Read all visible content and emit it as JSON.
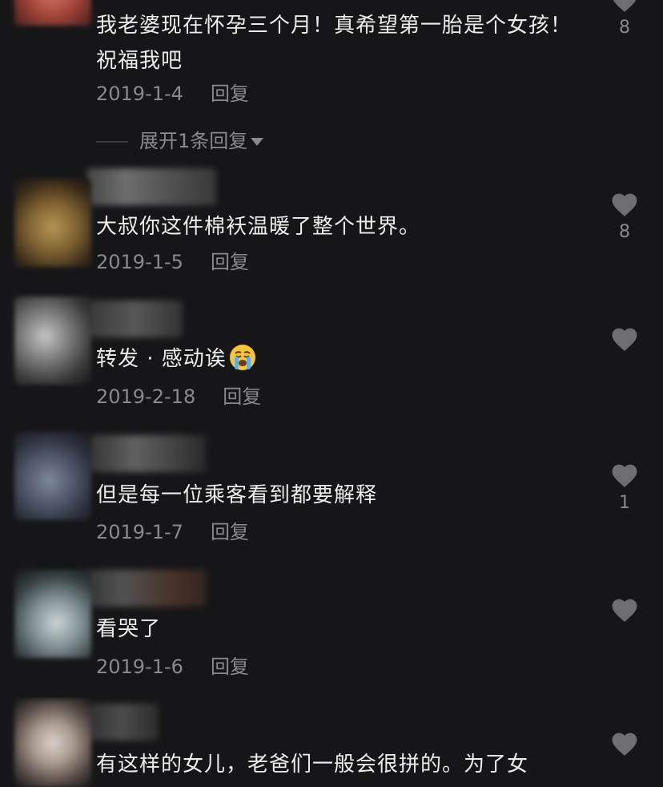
{
  "comments": [
    {
      "text": "我老婆现在怀孕三个月！真希望第一胎是个女孩！祝福我吧",
      "date": "2019-1-4",
      "reply_label": "回复",
      "likes": "8",
      "expand_label": "展开1条回复"
    },
    {
      "text": "大叔你这件棉袄温暖了整个世界。",
      "date": "2019-1-5",
      "reply_label": "回复",
      "likes": "8"
    },
    {
      "text": "转发 · 感动诶",
      "emoji": "loudly-crying-face-emoji",
      "date": "2019-2-18",
      "reply_label": "回复",
      "likes": ""
    },
    {
      "text": "但是每一位乘客看到都要解释",
      "date": "2019-1-7",
      "reply_label": "回复",
      "likes": "1"
    },
    {
      "text": "看哭了",
      "date": "2019-1-6",
      "reply_label": "回复",
      "likes": ""
    },
    {
      "text": "有这样的女儿，老爸们一般会很拼的。为了女",
      "likes": ""
    }
  ],
  "icons": {
    "like": "heart-icon",
    "expand": "caret-down-icon"
  },
  "colors": {
    "background": "#161618",
    "text_primary": "#ececec",
    "text_secondary": "#8a8a8e",
    "heart": "#6e6e72"
  }
}
